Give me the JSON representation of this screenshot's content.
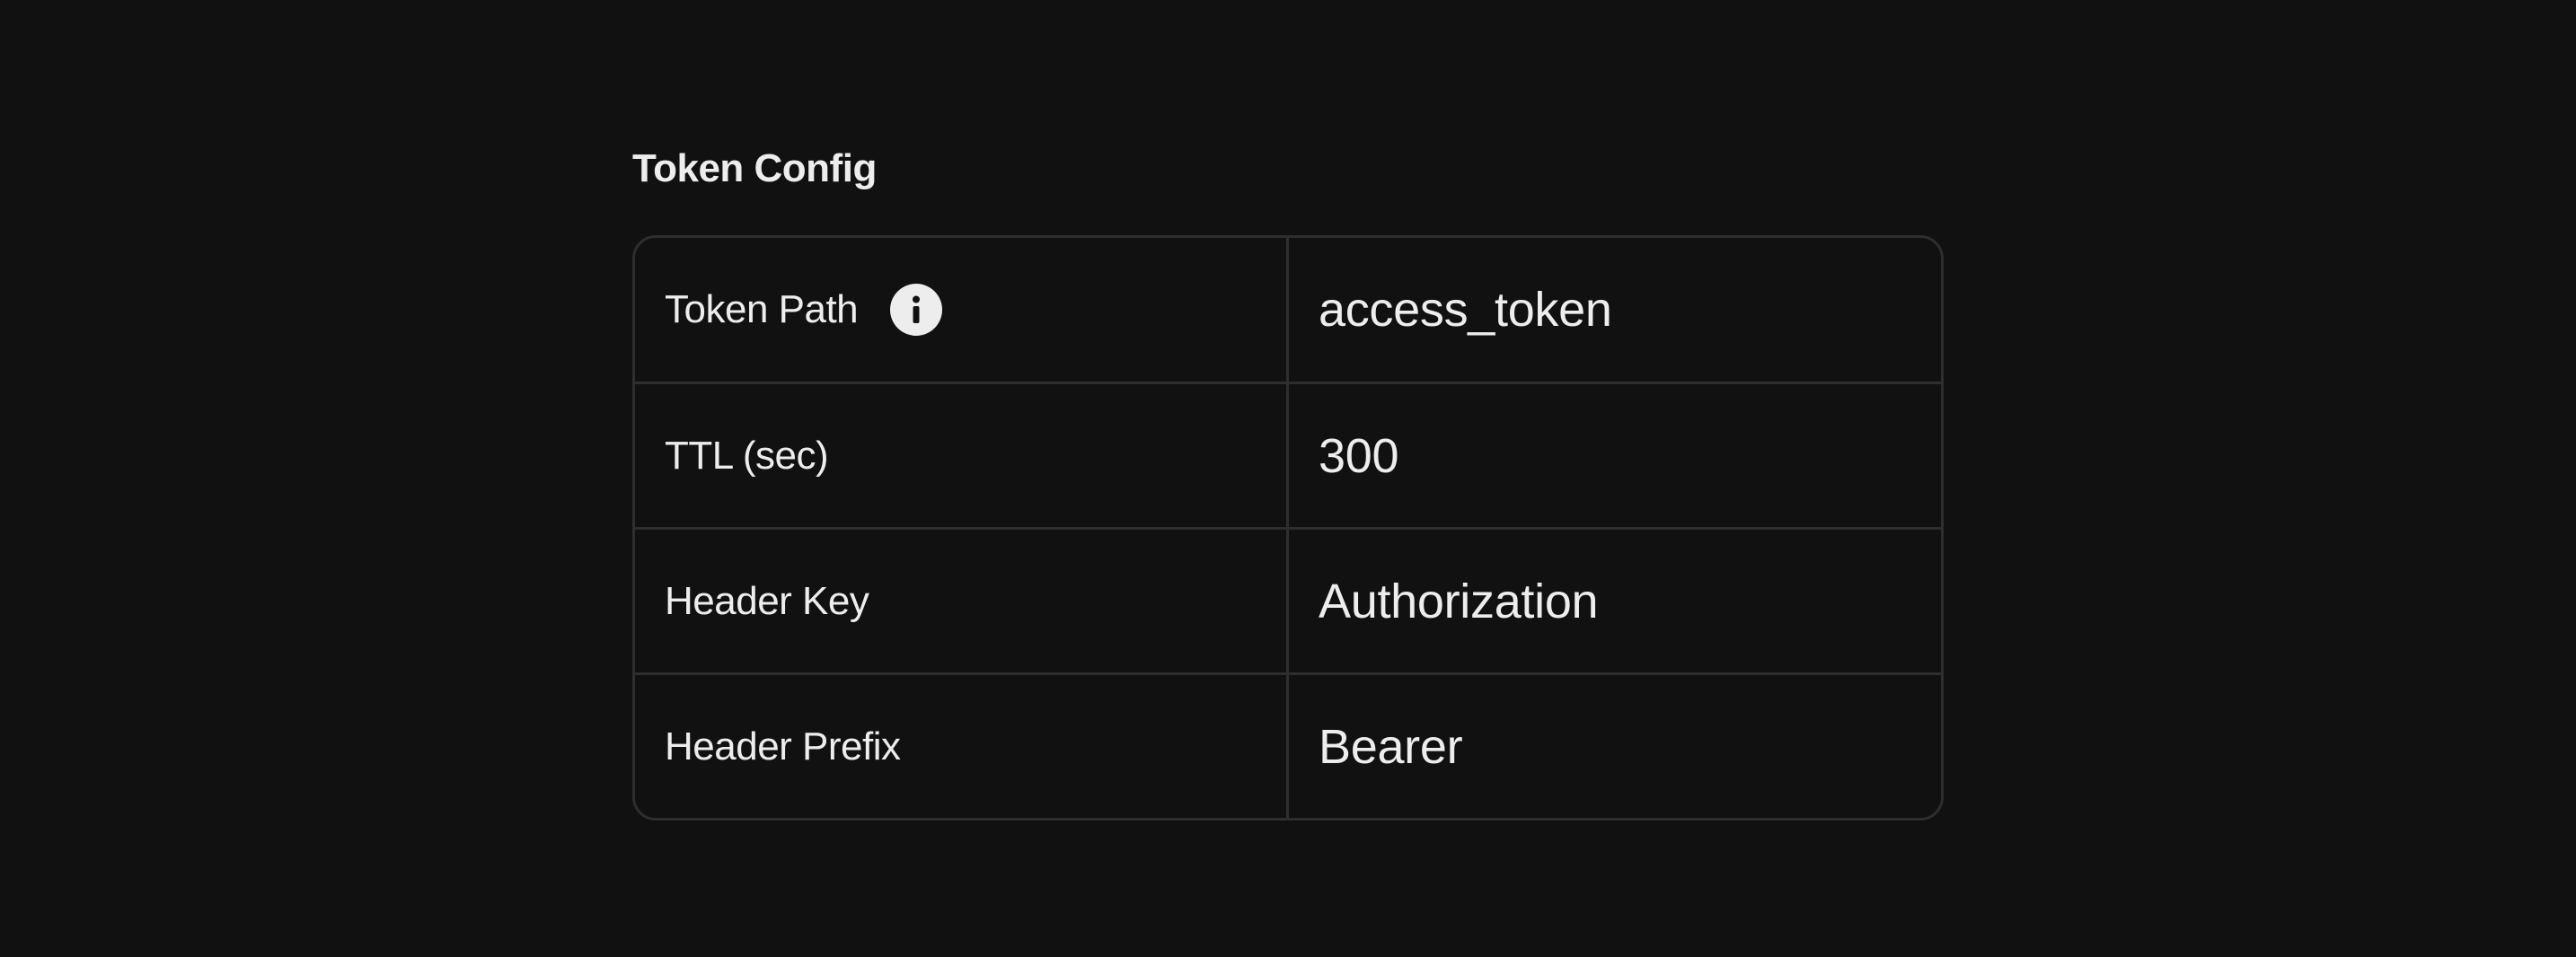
{
  "section": {
    "title": "Token Config"
  },
  "rows": [
    {
      "label": "Token Path",
      "value": "access_token",
      "icon": "info-icon"
    },
    {
      "label": "TTL (sec)",
      "value": "300"
    },
    {
      "label": "Header Key",
      "value": "Authorization"
    },
    {
      "label": "Header Prefix",
      "value": "Bearer"
    }
  ],
  "colors": {
    "background": "#111111",
    "border": "#2e2e2e",
    "text": "#ededed"
  }
}
